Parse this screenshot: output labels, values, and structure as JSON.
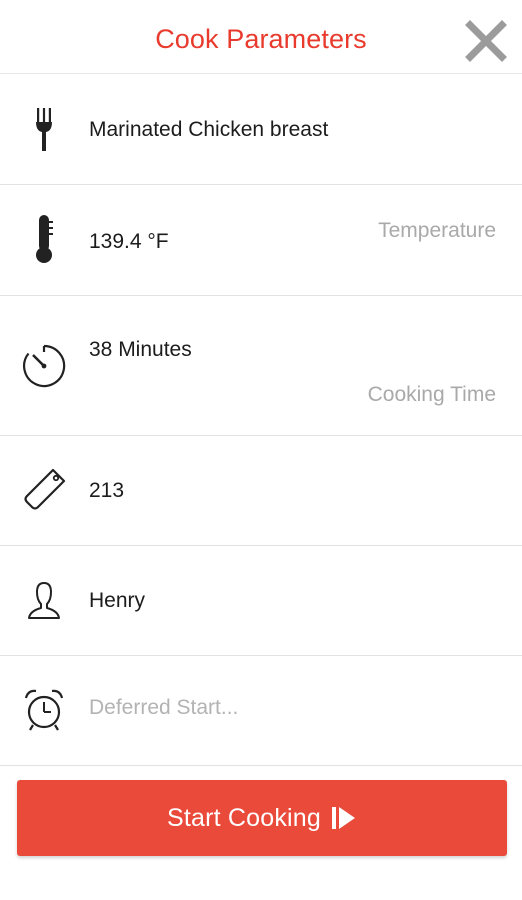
{
  "header": {
    "title": "Cook Parameters",
    "close_icon": "close-icon",
    "accent_color": "#e83a2d"
  },
  "params": {
    "recipe": {
      "icon": "fork-icon",
      "value": "Marinated Chicken breast"
    },
    "temperature": {
      "icon": "thermometer-icon",
      "value": "139.4 °F",
      "label": "Temperature"
    },
    "cooking_time": {
      "icon": "timer-icon",
      "value": "38 Minutes",
      "label": "Cooking Time"
    },
    "tag": {
      "icon": "tag-icon",
      "value": "213"
    },
    "user": {
      "icon": "person-icon",
      "value": "Henry"
    },
    "deferred_start": {
      "icon": "alarm-clock-icon",
      "placeholder": "Deferred Start..."
    }
  },
  "start_button": {
    "label": "Start Cooking",
    "icon": "play-step-icon",
    "color": "#ea4a3a"
  }
}
